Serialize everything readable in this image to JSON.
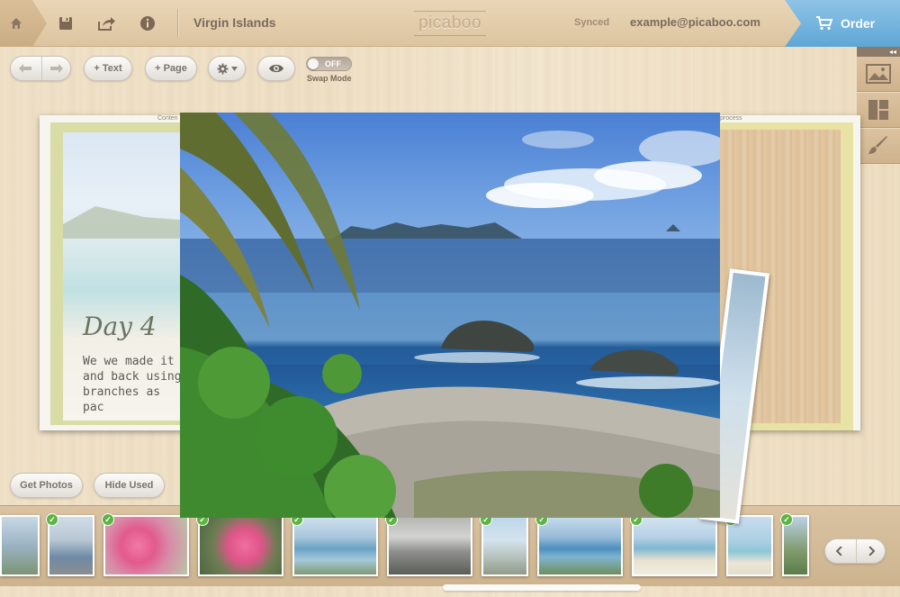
{
  "header": {
    "project_title": "Virgin Islands",
    "logo_text": "picaboo",
    "sync_status": "Synced",
    "user_email": "example@picaboo.com",
    "order_label": "Order",
    "icons": [
      "home-icon",
      "save-icon",
      "share-icon",
      "info-icon",
      "cart-icon"
    ]
  },
  "toolbar": {
    "text_label": "Text",
    "page_label": "Page",
    "swap_state": "OFF",
    "swap_label": "Swap Mode",
    "icons": [
      "undo-icon",
      "redo-icon",
      "gear-icon",
      "eye-icon"
    ]
  },
  "side_panel": {
    "collapse_glyph": "◂◂",
    "icons": [
      "image-icon",
      "layout-icon",
      "brush-icon"
    ]
  },
  "book": {
    "left_label": "Conten",
    "right_label": "process",
    "heading": "Day 4",
    "body": "We we made it\nand back using\nbranches as pac"
  },
  "bottom": {
    "get_photos": "Get Photos",
    "hide_used": "Hide Used"
  },
  "colors": {
    "order_blue": "#5ea7d6",
    "used_check_green": "#5db344"
  }
}
